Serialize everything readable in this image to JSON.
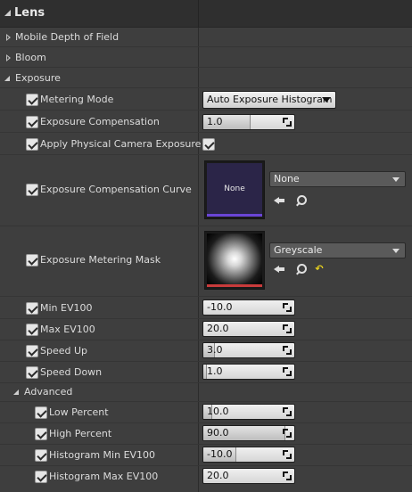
{
  "header": {
    "title": "Lens"
  },
  "sections": {
    "mobile_dof": "Mobile Depth of Field",
    "bloom": "Bloom",
    "exposure": "Exposure",
    "advanced": "Advanced"
  },
  "exposure": {
    "metering_mode": {
      "label": "Metering Mode",
      "value": "Auto Exposure Histogram"
    },
    "exposure_compensation": {
      "label": "Exposure Compensation",
      "value": "1.0",
      "slider_fraction": 0.5
    },
    "apply_physical": {
      "label": "Apply Physical Camera Exposure",
      "checked": true
    },
    "compensation_curve": {
      "label": "Exposure Compensation Curve",
      "thumb_text": "None",
      "asset": "None"
    },
    "metering_mask": {
      "label": "Exposure Metering Mask",
      "asset": "Greyscale"
    },
    "min_ev100": {
      "label": "Min EV100",
      "value": "-10.0"
    },
    "max_ev100": {
      "label": "Max EV100",
      "value": "20.0"
    },
    "speed_up": {
      "label": "Speed Up",
      "value": "3.0",
      "slider_fraction": 0.12
    },
    "speed_down": {
      "label": "Speed Down",
      "value": "1.0",
      "slider_fraction": 0.04
    }
  },
  "advanced": {
    "low_percent": {
      "label": "Low Percent",
      "value": "10.0",
      "slider_fraction": 0.1
    },
    "high_percent": {
      "label": "High Percent",
      "value": "90.0",
      "slider_fraction": 0.9
    },
    "hist_min_ev100": {
      "label": "Histogram Min EV100",
      "value": "-10.0",
      "slider_fraction": 0.36
    },
    "hist_max_ev100": {
      "label": "Histogram Max EV100",
      "value": "20.0"
    }
  },
  "icons": {
    "use_selected": "arrow-left-icon",
    "browse": "magnifier-icon",
    "reset": "reset-to-default-icon"
  },
  "colors": {
    "curve_thumb_bg": "#2b2548",
    "curve_thumb_bar": "#6a45d6",
    "mask_thumb_bar": "#c83b3b",
    "reset_icon": "#e6d01e"
  }
}
